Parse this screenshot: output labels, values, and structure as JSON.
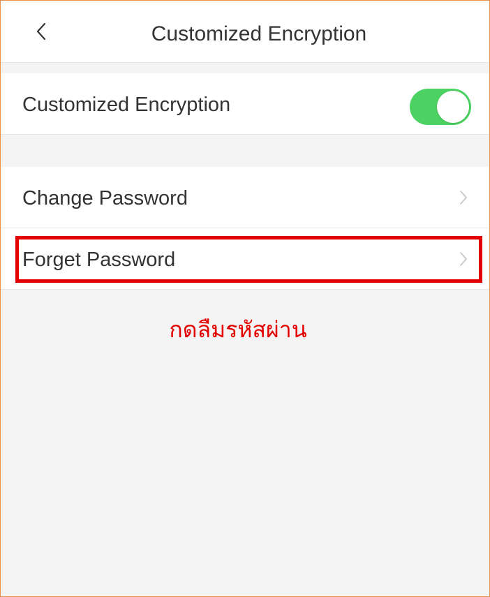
{
  "header": {
    "title": "Customized Encryption",
    "back_icon": "chevron-left-icon"
  },
  "encryption_section": {
    "toggle_label": "Customized Encryption",
    "toggle_state": "on",
    "toggle_color": "#4cd262"
  },
  "password_section": {
    "items": [
      {
        "label": "Change Password",
        "icon": "chevron-right-icon"
      },
      {
        "label": "Forget Password",
        "icon": "chevron-right-icon"
      }
    ]
  },
  "annotation": {
    "text": "กดลืมรหัสผ่าน",
    "color": "#e30000"
  }
}
